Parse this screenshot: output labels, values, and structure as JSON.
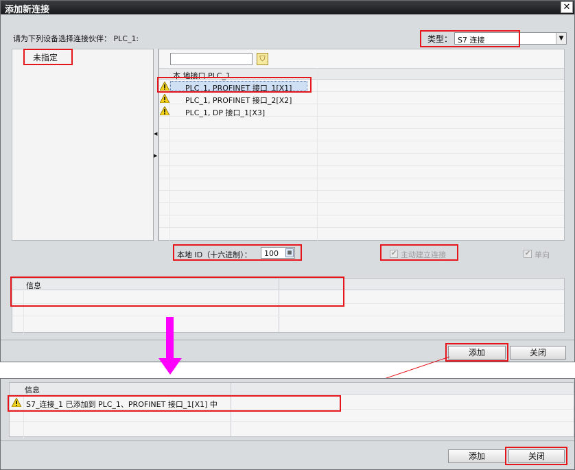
{
  "dialog": {
    "title": "添加新连接",
    "close_glyph": "✕",
    "partner_prompt": "请为下列设备选择连接伙伴： PLC_1:",
    "type_label": "类型：",
    "type_value": "S7 连接",
    "unspecified": "未指定",
    "local_interface_header": "本 地接口 PLC_1",
    "interfaces": [
      "PLC_1, PROFINET 接口_1[X1]",
      "PLC_1, PROFINET 接口_2[X2]",
      "PLC_1, DP 接口_1[X3]"
    ],
    "local_id_label": "本地 ID（十六进制）：",
    "local_id_value": "100",
    "active_connect_label": "主动建立连接",
    "one_way_label": "单向",
    "info_header": "信息",
    "add_button": "添加",
    "close_button": "关闭"
  },
  "result": {
    "info_header": "信息",
    "message": "S7_连接_1 已添加到 PLC_1、PROFINET 接口_1[X1] 中",
    "add_button": "添加",
    "close_button": "关闭"
  },
  "colors": {
    "annotation_red": "#e4161b",
    "arrow_magenta": "#ff00ff"
  }
}
